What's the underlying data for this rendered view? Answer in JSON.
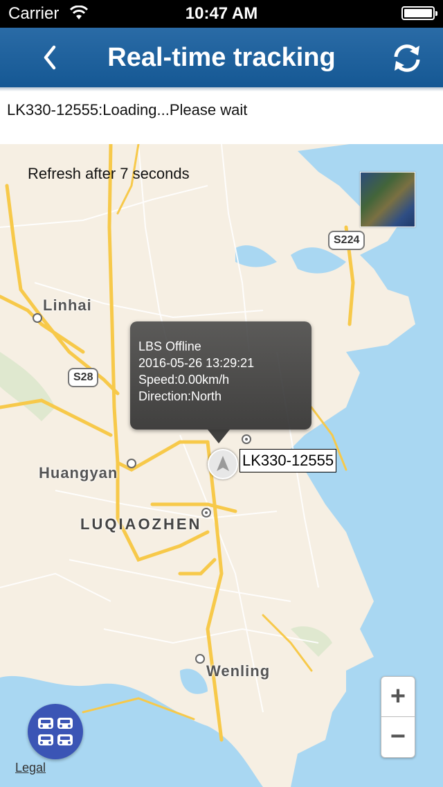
{
  "status_bar": {
    "carrier": "Carrier",
    "time": "10:47 AM"
  },
  "navbar": {
    "title": "Real-time tracking",
    "back_icon": "chevron-left-icon",
    "refresh_icon": "refresh-icon"
  },
  "status_text": "LK330-12555:Loading...Please wait",
  "map": {
    "refresh_note": "Refresh after 7 seconds",
    "cities": {
      "linhai": "Linhai",
      "huangyan": "Huangyan",
      "luqiaozhen": "LUQIAOZHEN",
      "wenling": "Wenling"
    },
    "road_signs": {
      "s224": "S224",
      "s28": "S28"
    },
    "popup": {
      "status": "LBS Offline",
      "datetime": "2016-05-26 13:29:21",
      "speed": "Speed:0.00km/h",
      "direction": "Direction:North"
    },
    "device_label": "LK330-12555",
    "zoom": {
      "in": "+",
      "out": "−"
    },
    "legal": "Legal",
    "colors": {
      "water": "#a9d7f2",
      "land": "#f6efe3",
      "road": "#f7c94a",
      "nav": "#1a5e9b",
      "fab": "#3b55b5"
    }
  }
}
